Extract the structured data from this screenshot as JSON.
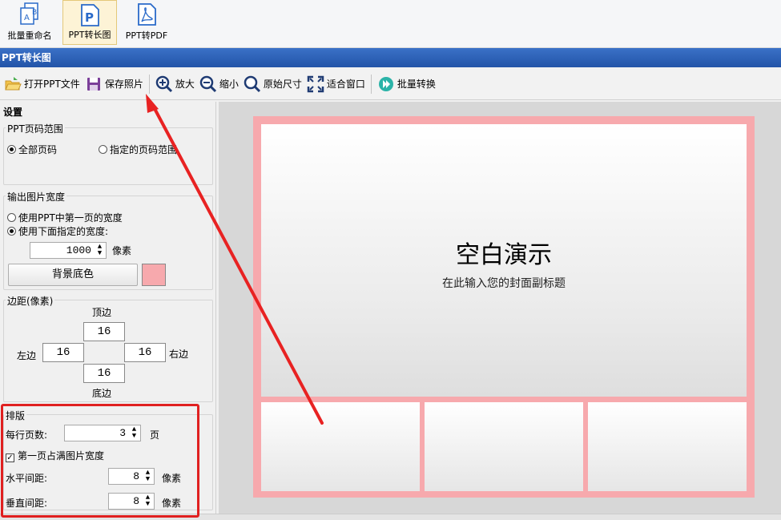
{
  "ribbon": {
    "items": [
      {
        "label": "批量重命名",
        "icon": "batch-rename-icon"
      },
      {
        "label": "PPT转长图",
        "icon": "ppt-icon",
        "active": true
      },
      {
        "label": "PPT转PDF",
        "icon": "pdf-icon"
      }
    ]
  },
  "titlebar": {
    "title": "PPT转长图"
  },
  "toolbar": {
    "open": "打开PPT文件",
    "save": "保存照片",
    "zoom_in": "放大",
    "zoom_out": "缩小",
    "original": "原始尺寸",
    "fit": "适合窗口",
    "batch": "批量转换"
  },
  "settings": {
    "header": "设置",
    "page_range": {
      "title": "PPT页码范围",
      "all": "全部页码",
      "specified": "指定的页码范围",
      "selected": "all"
    },
    "width": {
      "title": "输出图片宽度",
      "use_first": "使用PPT中第一页的宽度",
      "use_custom": "使用下面指定的宽度:",
      "value": "1000",
      "unit": "像素",
      "bg_button": "背景底色",
      "bg_color": "#f7a9ad"
    },
    "margins": {
      "title": "边距(像素)",
      "top_label": "顶边",
      "bottom_label": "底边",
      "left_label": "左边",
      "right_label": "右边",
      "top": "16",
      "bottom": "16",
      "left": "16",
      "right": "16"
    },
    "layout": {
      "title": "排版",
      "per_row_label": "每行页数:",
      "per_row_value": "3",
      "per_row_unit": "页",
      "first_full": "第一页占满图片宽度",
      "first_full_checked": true,
      "h_spacing_label": "水平间距:",
      "h_spacing_value": "8",
      "h_spacing_unit": "像素",
      "v_spacing_label": "垂直间距:",
      "v_spacing_value": "8",
      "v_spacing_unit": "像素"
    }
  },
  "preview": {
    "slide_title": "空白演示",
    "slide_subtitle": "在此输入您的封面副标题"
  },
  "colors": {
    "accent_blue": "#2c5fb5",
    "annotation_red": "#e02020",
    "page_background": "#f7a9ad"
  }
}
